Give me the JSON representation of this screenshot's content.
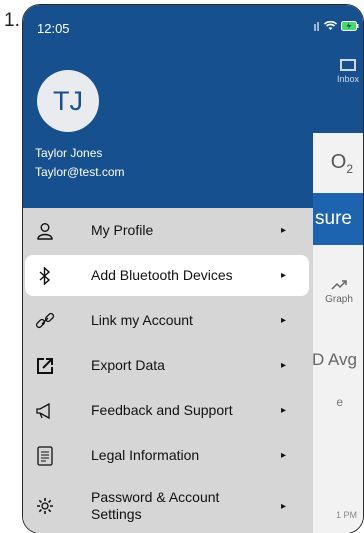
{
  "step": {
    "number": "1."
  },
  "status": {
    "time": "12:05"
  },
  "user": {
    "initials": "TJ",
    "name": "Taylor Jones",
    "email": "Taylor@test.com"
  },
  "menu": {
    "items": [
      {
        "label": "My Profile",
        "icon": "person-icon"
      },
      {
        "label": "Add Bluetooth Devices",
        "icon": "bluetooth-icon"
      },
      {
        "label": "Link my Account",
        "icon": "link-icon"
      },
      {
        "label": "Export Data",
        "icon": "export-icon"
      },
      {
        "label": "Feedback and Support",
        "icon": "megaphone-icon"
      },
      {
        "label": "Legal Information",
        "icon": "document-icon"
      },
      {
        "label": "Password & Account Settings",
        "icon": "gear-icon"
      }
    ],
    "chevron": "▸"
  },
  "background": {
    "inbox_label": "Inbox",
    "o2_label": "O",
    "o2_sub": "2",
    "measure_label": "sure",
    "graph_label": "Graph",
    "avg_label": "D Avg",
    "e_label": "e",
    "pm_label": "1 PM"
  },
  "colors": {
    "header": "#16508e",
    "drawer": "#d6d6d6",
    "highlight": "#ffffff",
    "button": "#1e63b0"
  }
}
